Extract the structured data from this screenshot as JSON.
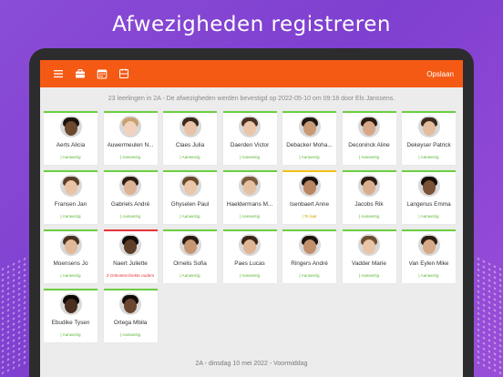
{
  "headline": "Afwezigheden registreren",
  "toolbar": {
    "icons": [
      "menu-icon",
      "briefcase-icon",
      "calendar-icon",
      "student-card-icon"
    ],
    "save_label": "Opslaan"
  },
  "status_line": "23 leerlingen in 2A  - De afwezigheden werden bevestigd op 2022-05-10 om 09:18 door Els Janssens.",
  "students": [
    {
      "name": "Aerts Alicia",
      "status": "| Aanwezig",
      "state": "present",
      "skin": "#6b4a2f",
      "hair": "#1b120c"
    },
    {
      "name": "Auwermeulen N...",
      "status": "| Aanwezig",
      "state": "present",
      "skin": "#f1d2bd",
      "hair": "#c9a070"
    },
    {
      "name": "Claes Julia",
      "status": "| Aanwezig",
      "state": "present",
      "skin": "#e7c2a6",
      "hair": "#3a2718"
    },
    {
      "name": "Daerden Victor",
      "status": "| Aanwezig",
      "state": "present",
      "skin": "#e9c6aa",
      "hair": "#4a3020"
    },
    {
      "name": "Debacker Moha...",
      "status": "| Aanwezig",
      "state": "present",
      "skin": "#c89a76",
      "hair": "#1f1610"
    },
    {
      "name": "Deconinck Aline",
      "status": "| Aanwezig",
      "state": "present",
      "skin": "#d7a789",
      "hair": "#2a1a10"
    },
    {
      "name": "Dekeyser Patrick",
      "status": "| Aanwezig",
      "state": "present",
      "skin": "#e3bc9e",
      "hair": "#3b2a1c"
    },
    {
      "name": "Fransen Jan",
      "status": "| Aanwezig",
      "state": "present",
      "skin": "#e8c3a5",
      "hair": "#5a3c26"
    },
    {
      "name": "Gabriels André",
      "status": "| Aanwezig",
      "state": "present",
      "skin": "#dcb394",
      "hair": "#2c1d12"
    },
    {
      "name": "Ghyselen Paul",
      "status": "| Aanwezig",
      "state": "present",
      "skin": "#ebc7aa",
      "hair": "#6a4a2c"
    },
    {
      "name": "Haeldermans M...",
      "status": "| Aanwezig",
      "state": "present",
      "skin": "#e6c0a2",
      "hair": "#7a5a3a"
    },
    {
      "name": "Isenbaert Anne",
      "status": "| Te laat",
      "state": "late",
      "skin": "#b98563",
      "hair": "#1a120c"
    },
    {
      "name": "Jacobs Rik",
      "status": "| Aanwezig",
      "state": "present",
      "skin": "#d9ae8e",
      "hair": "#2b1c12"
    },
    {
      "name": "Langenus Emma",
      "status": "| Aanwezig",
      "state": "present",
      "skin": "#7a5236",
      "hair": "#140d08"
    },
    {
      "name": "Moensens Jo",
      "status": "| Aanwezig",
      "state": "present",
      "skin": "#e2b998",
      "hair": "#4b3220"
    },
    {
      "name": "Naert Juliette",
      "status": "Z Onkosten/ziekte ouders",
      "state": "absent",
      "skin": "#5e3f29",
      "hair": "#120b07"
    },
    {
      "name": "Ornelis Sofia",
      "status": "| Aanwezig",
      "state": "present",
      "skin": "#c79673",
      "hair": "#2a1a10"
    },
    {
      "name": "Paes Lucas",
      "status": "| Aanwezig",
      "state": "present",
      "skin": "#e0b595",
      "hair": "#3a2616"
    },
    {
      "name": "Ringers André",
      "status": "| Aanwezig",
      "state": "present",
      "skin": "#c2906c",
      "hair": "#1d140c"
    },
    {
      "name": "Vadder Marie",
      "status": "| Aanwezig",
      "state": "present",
      "skin": "#e9c4a6",
      "hair": "#6e4e30"
    },
    {
      "name": "Van Eylen Mike",
      "status": "| Aanwezig",
      "state": "present",
      "skin": "#d6aa86",
      "hair": "#2e1e12"
    },
    {
      "name": "Ebudike Tysen",
      "status": "| Aanwezig",
      "state": "present",
      "skin": "#4a3020",
      "hair": "#0f0a06"
    },
    {
      "name": "Ortega Mbila",
      "status": "| Aanwezig",
      "state": "present",
      "skin": "#6a4530",
      "hair": "#120c08"
    }
  ],
  "footer": "2A   - dinsdag 10 mei 2022 - Voormiddag",
  "colors": {
    "background": "#8a4dd6",
    "toolbar": "#f55a14",
    "present": "#6bcf3f",
    "late": "#f3c21c",
    "absent": "#e5333b"
  }
}
